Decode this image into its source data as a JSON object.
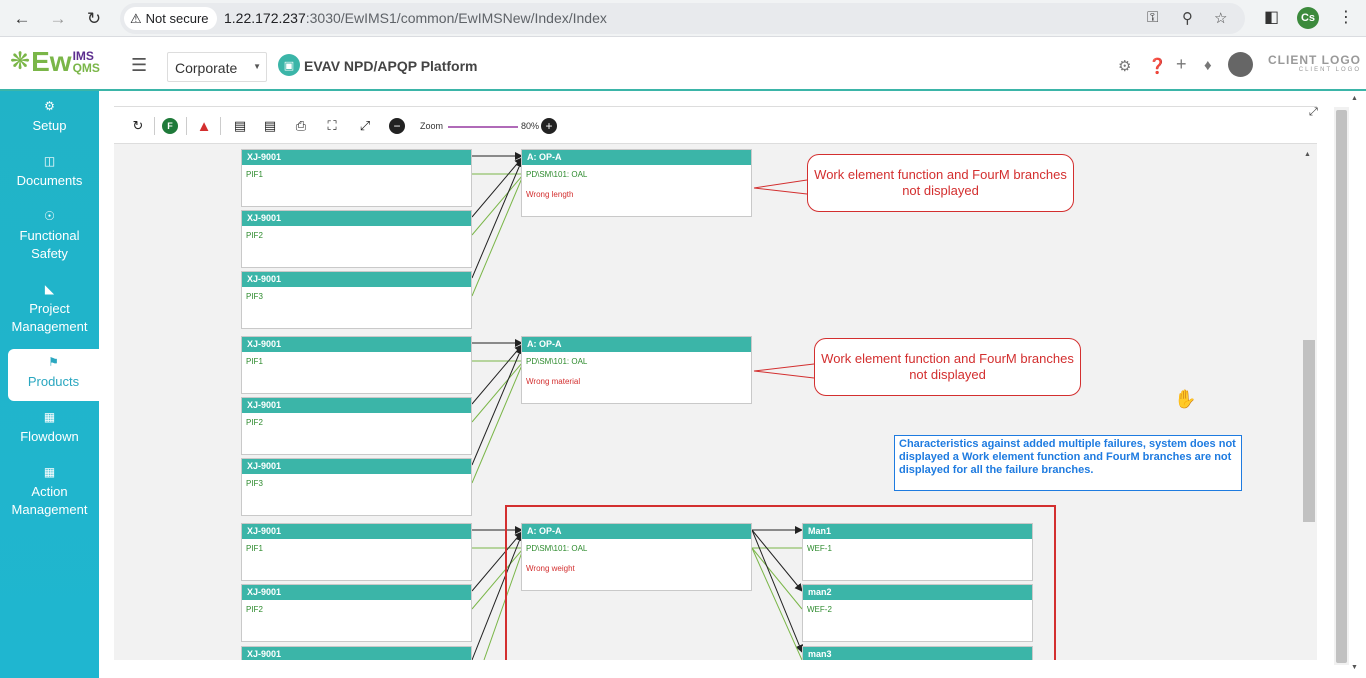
{
  "browser": {
    "security_label": "Not secure",
    "url_host": "1.22.172.237",
    "url_path": ":3030/EwIMS1/common/EwIMSNew/Index/Index",
    "profile_initials": "Cs"
  },
  "header": {
    "logo_text": "Ew",
    "logo_ims": "IMS",
    "logo_qms": "QMS",
    "selected_unit": "Corporate",
    "platform_title": "EVAV NPD/APQP Platform",
    "client_logo": "CLIENT LOGO",
    "client_logo_sub": "CLIENT LOGO"
  },
  "sidebar": {
    "items": [
      {
        "label": "Setup",
        "icon": "gears-icon"
      },
      {
        "label": "Documents",
        "icon": "document-icon"
      },
      {
        "label": "Functional Safety",
        "icon": "shield-icon"
      },
      {
        "label": "Project Management",
        "icon": "hierarchy-icon"
      },
      {
        "label": "Products",
        "icon": "product-icon",
        "active": true
      },
      {
        "label": "Flowdown",
        "icon": "building-icon"
      },
      {
        "label": "Action Management",
        "icon": "building-icon"
      }
    ]
  },
  "toolbar": {
    "zoom_label": "Zoom",
    "zoom_value": "80%",
    "zoom_level": 0.8,
    "f_label": "F"
  },
  "diagram": {
    "source_title": "XJ-9001",
    "pif1": "PIF1",
    "pif2": "PIF2",
    "pif3": "PIF3",
    "op_title": "A: OP-A",
    "op_code": "PD\\SM\\101: OAL",
    "failures": [
      "Wrong length",
      "Wrong material",
      "Wrong weight"
    ],
    "work_elements": [
      {
        "title": "Man1",
        "function": "WEF-1"
      },
      {
        "title": "man2",
        "function": "WEF-2"
      },
      {
        "title": "man3",
        "function": ""
      }
    ]
  },
  "annotations": {
    "callout_1": "Work element function and FourM branches not displayed",
    "callout_2": "Work element function and FourM branches not displayed",
    "note": "Characteristics against added multiple failures, system does not displayed a Work element function and FourM branches are not displayed for all the failure branches."
  },
  "colors": {
    "accent": "#3bb5a8",
    "sidebar": "#21b3c7",
    "alert": "#d32f2f",
    "note": "#1e7be0"
  }
}
